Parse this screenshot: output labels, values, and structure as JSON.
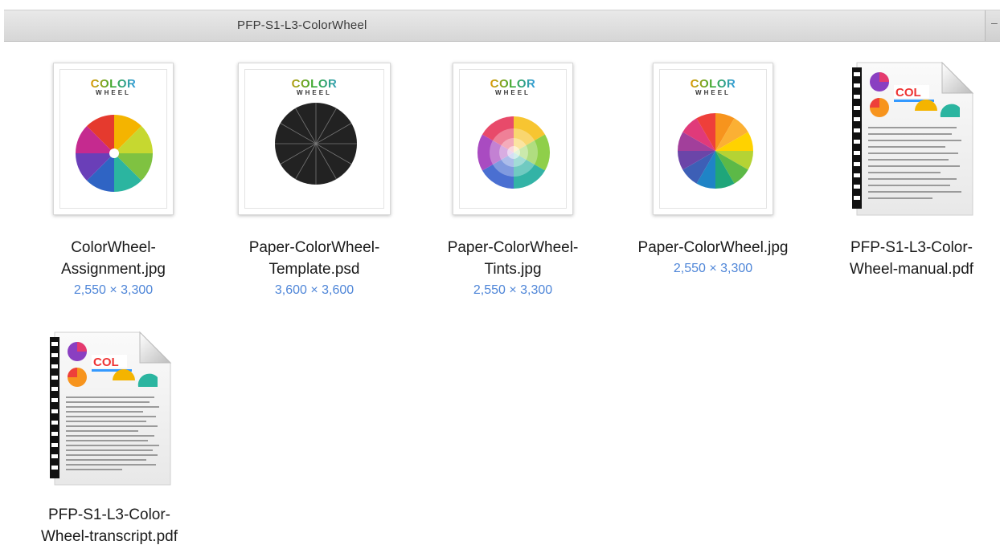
{
  "window": {
    "title": "PFP-S1-L3-ColorWheel"
  },
  "logo": {
    "color": "COLOR",
    "wheel": "WHEEL"
  },
  "files": [
    {
      "name_line1": "ColorWheel-",
      "name_line2": "Assignment.jpg",
      "dims": "2,550 × 3,300"
    },
    {
      "name_line1": "Paper-ColorWheel-",
      "name_line2": "Template.psd",
      "dims": "3,600 × 3,600"
    },
    {
      "name_line1": "Paper-ColorWheel-",
      "name_line2": "Tints.jpg",
      "dims": "2,550 × 3,300"
    },
    {
      "name_line1": "Paper-ColorWheel.jpg",
      "name_line2": "",
      "dims": "2,550 × 3,300"
    },
    {
      "name_line1": "PFP-S1-L3-Color-",
      "name_line2": "Wheel-manual.pdf",
      "dims": ""
    },
    {
      "name_line1": "PFP-S1-L3-Color-",
      "name_line2": "Wheel-transcript.pdf",
      "dims": ""
    }
  ],
  "colors": {
    "dims_text": "#4f86d8",
    "titlebar": "#dcdcdc"
  },
  "icons": [
    "image-thumbnail-icon",
    "pdf-document-icon"
  ]
}
